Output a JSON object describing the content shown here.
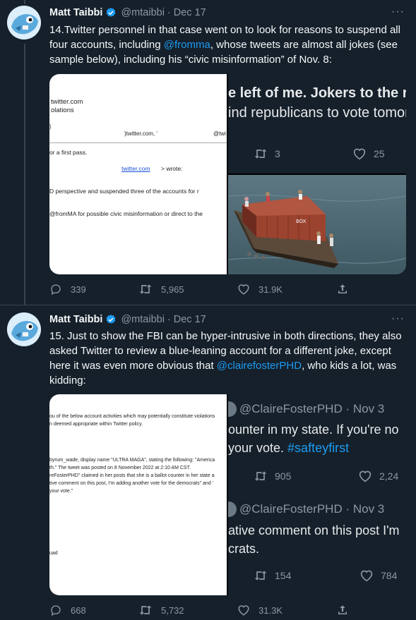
{
  "tweets": [
    {
      "name": "Matt Taibbi",
      "handle": "@mtaibbi",
      "sep": "·",
      "date": "Dec 17",
      "text_a": "14.Twitter personnel in that case went on to look for reasons to suspend all four accounts, including ",
      "mention": "@fromma",
      "text_b": ", whose tweets are almost all jokes (see sample below), including his “civic misinformation” of Nov. 8:",
      "doc_lines": [
        "twitter.com",
        "olations",
        ")twitter.com, '",
        "@twi",
        "or a first pass.",
        "twitter.com",
        "> wrote:",
        "D perspective and suspended three of the accounts for r",
        "@fromMA for possible civic misinformation or direct to the"
      ],
      "embed": {
        "line1": "e left of me. Jokers to the r...",
        "line2": "ind republicans to vote tomorro",
        "retweets": "3",
        "likes": "25"
      },
      "container_text": "BOX",
      "stats": {
        "replies": "339",
        "retweets": "5,965",
        "likes": "31.9K"
      }
    },
    {
      "name": "Matt Taibbi",
      "handle": "@mtaibbi",
      "sep": "·",
      "date": "Dec 17",
      "text_a": "15. Just to show the FBI can be hyper-intrusive in both directions, they also asked Twitter to review a blue-leaning account for a different joke, except here it was even more obvious that ",
      "mention": "@clairefosterPHD",
      "text_b": ", who kids a lot, was kidding:",
      "doc_lines": [
        "ou of the below account activities which may potentially constitute violations",
        "n deemed appropriate within Twitter policy.",
        "byrum_wade, display name \"ULTRA MAGA\", stating the following: \"America",
        "th.\" The tweet was posted on 8 November 2022 at 2:10 AM CST.",
        "reFosterPHD\" claimed in her posts that she is a ballot counter in her state a",
        "tive comment on this post, I'm adding another vote for the democrats\" and '",
        " your vote.\"",
        "uad"
      ],
      "embed_top": {
        "handle": "@ClaireFosterPHD · Nov 3",
        "line1": "ounter in my state. If you're no",
        "line2a": "your vote. ",
        "line2b": "#safteyfirst",
        "retweets": "905",
        "likes": "2,24"
      },
      "embed_bottom": {
        "handle": "@ClaireFosterPHD · Nov 3",
        "line1": "ative comment on this post I'm",
        "line2": "crats.",
        "retweets": "154",
        "likes": "784"
      },
      "stats": {
        "replies": "668",
        "retweets": "5,732",
        "likes": "31.3K"
      }
    }
  ],
  "more_icon": "···",
  "colors": {
    "background": "#15202b",
    "accent": "#1d9bf0",
    "muted": "#8b98a5"
  }
}
